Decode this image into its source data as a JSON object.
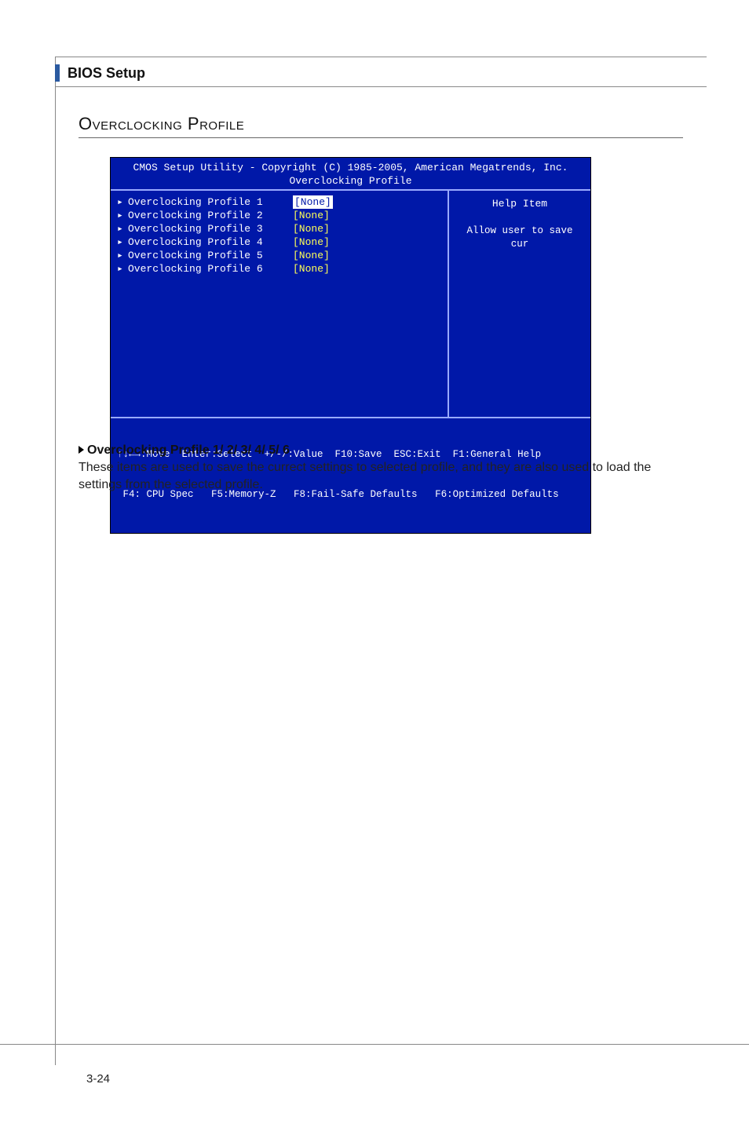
{
  "header": {
    "label": "BIOS Setup"
  },
  "section": {
    "title": "Overclocking Profile"
  },
  "bios": {
    "copyright": "CMOS Setup Utility - Copyright (C) 1985-2005, American Megatrends, Inc.",
    "subtitle": "Overclocking Profile",
    "items": [
      {
        "label": "Overclocking Profile 1",
        "value": "[None]",
        "selected": true
      },
      {
        "label": "Overclocking Profile 2",
        "value": "[None]",
        "selected": false
      },
      {
        "label": "Overclocking Profile 3",
        "value": "[None]",
        "selected": false
      },
      {
        "label": "Overclocking Profile 4",
        "value": "[None]",
        "selected": false
      },
      {
        "label": "Overclocking Profile 5",
        "value": "[None]",
        "selected": false
      },
      {
        "label": "Overclocking Profile 6",
        "value": "[None]",
        "selected": false
      }
    ],
    "help": {
      "title": "Help Item",
      "text": "Allow user to save cur"
    },
    "footer": {
      "line1": "↑↓←→:Move  Enter:Select  +/-/:Value  F10:Save  ESC:Exit  F1:General Help",
      "line2": " F4: CPU Spec   F5:Memory-Z   F8:Fail-Safe Defaults   F6:Optimized Defaults"
    }
  },
  "body": {
    "heading": "Overclocking Profile 1/ 2/ 3/ 4/ 5/ 6",
    "paragraph": "These items are used to save the currect settings to selected profile, and they are also used to load the settings from the selected profile."
  },
  "page_number": "3-24"
}
